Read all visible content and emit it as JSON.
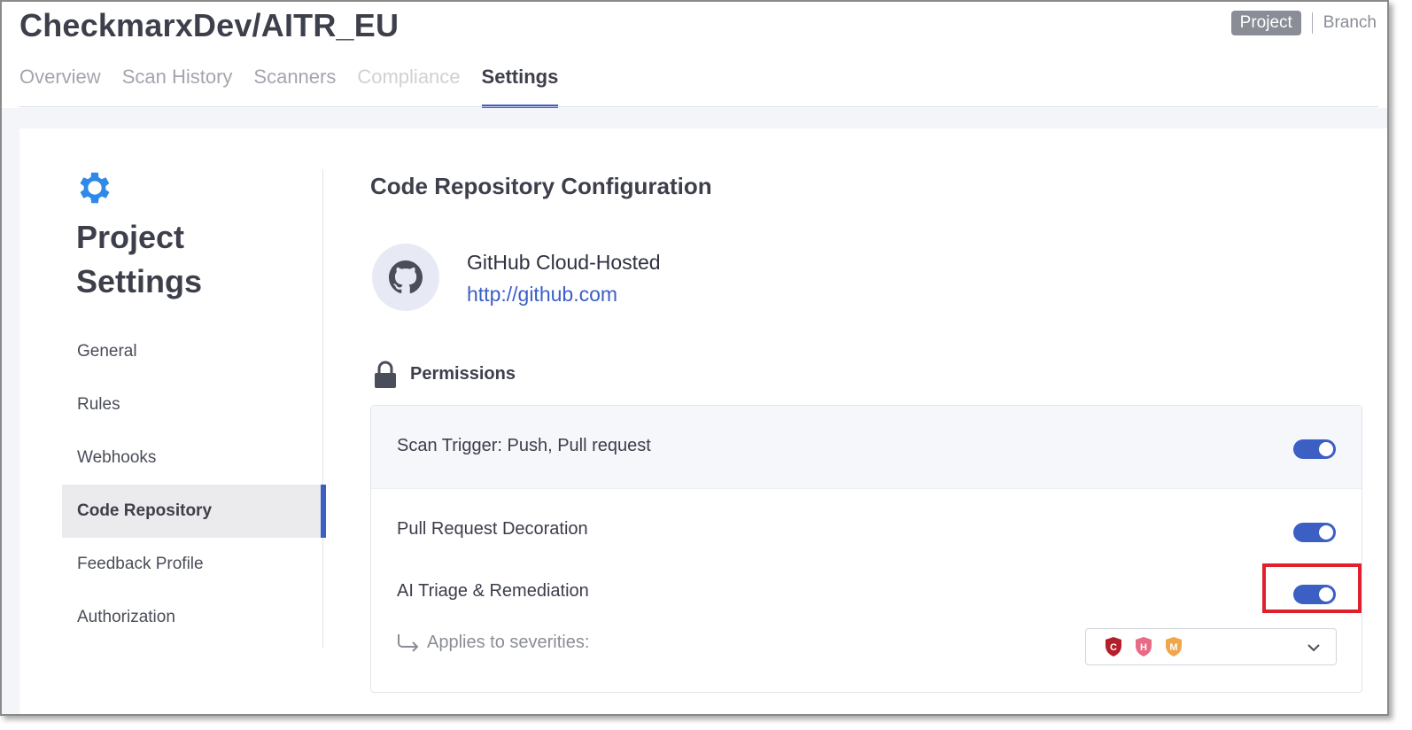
{
  "header": {
    "project_title": "CheckmarxDev/AITR_EU",
    "scope_project": "Project",
    "scope_branch": "Branch"
  },
  "tabs": [
    {
      "label": "Overview",
      "state": "normal"
    },
    {
      "label": "Scan History",
      "state": "normal"
    },
    {
      "label": "Scanners",
      "state": "normal"
    },
    {
      "label": "Compliance",
      "state": "disabled"
    },
    {
      "label": "Settings",
      "state": "active"
    }
  ],
  "sidebar": {
    "icon": "gear-icon",
    "title_line1": "Project",
    "title_line2": "Settings",
    "items": [
      {
        "label": "General"
      },
      {
        "label": "Rules"
      },
      {
        "label": "Webhooks"
      },
      {
        "label": "Code Repository",
        "active": true
      },
      {
        "label": "Feedback Profile"
      },
      {
        "label": "Authorization"
      }
    ]
  },
  "main": {
    "section_title": "Code Repository Configuration",
    "repo": {
      "icon": "github-icon",
      "name": "GitHub Cloud-Hosted",
      "url": "http://github.com"
    },
    "permissions": {
      "label": "Permissions",
      "icon": "lock-icon",
      "rows": [
        {
          "label": "Scan Trigger: Push, Pull request",
          "enabled": true
        },
        {
          "label": "Pull Request Decoration",
          "enabled": true
        },
        {
          "label": "AI Triage & Remediation",
          "enabled": true
        }
      ],
      "applies_label": "Applies to severities:",
      "severities": [
        {
          "letter": "C",
          "color": "#b3202b"
        },
        {
          "letter": "H",
          "color": "#e76b86"
        },
        {
          "letter": "M",
          "color": "#f0a64a"
        }
      ]
    }
  },
  "colors": {
    "accent": "#3c5fc4",
    "highlight": "#e0202a"
  }
}
